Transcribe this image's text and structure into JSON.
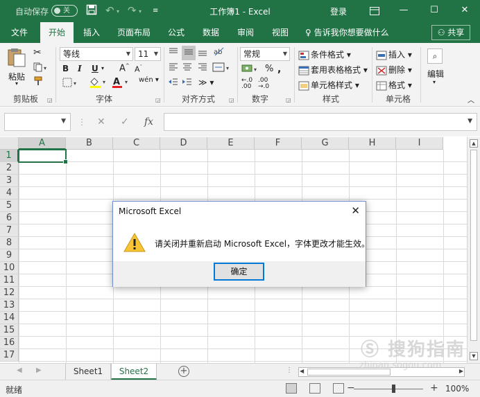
{
  "window": {
    "autosave_label": "自动保存",
    "autosave_state": "关",
    "title": "工作簿1  -  Excel",
    "login_label": "登录"
  },
  "ribbon_tabs": [
    "文件",
    "开始",
    "插入",
    "页面布局",
    "公式",
    "数据",
    "审阅",
    "视图"
  ],
  "active_tab": "开始",
  "tell_me": "告诉我你想要做什么",
  "share_label": "共享",
  "ribbon": {
    "clipboard": {
      "paste": "粘贴",
      "label": "剪贴板"
    },
    "font": {
      "name": "等线",
      "size": "11",
      "label": "字体",
      "bold": "B",
      "italic": "I",
      "underline": "U"
    },
    "alignment": {
      "label": "对齐方式"
    },
    "number": {
      "format": "常规",
      "label": "数字"
    },
    "styles": {
      "conditional": "条件格式",
      "table": "套用表格格式",
      "cell_styles": "单元格样式",
      "label": "样式"
    },
    "cells": {
      "insert": "插入",
      "delete": "删除",
      "format": "格式",
      "label": "单元格"
    },
    "editing": {
      "label": "编辑"
    }
  },
  "formula_bar": {
    "fx": "fx",
    "name_box": "",
    "content": ""
  },
  "grid": {
    "columns": [
      "A",
      "B",
      "C",
      "D",
      "E",
      "F",
      "G",
      "H",
      "I"
    ],
    "rows": [
      "1",
      "2",
      "3",
      "4",
      "5",
      "6",
      "7",
      "8",
      "9",
      "10",
      "11",
      "12",
      "13",
      "14",
      "15",
      "16",
      "17"
    ],
    "active_cell": "A1"
  },
  "sheets": [
    "Sheet1",
    "Sheet2"
  ],
  "active_sheet": "Sheet2",
  "status": {
    "ready": "就绪",
    "zoom": "100%"
  },
  "dialog": {
    "title": "Microsoft Excel",
    "message": "请关闭并重新启动 Microsoft Excel，字体更改才能生效。",
    "ok": "确定"
  },
  "watermark": {
    "text": "搜狗指南",
    "url": "zhinan.sogou.com"
  },
  "colors": {
    "accent": "#217346",
    "dialog_border": "#6c8fcc",
    "focus": "#0078d7"
  }
}
